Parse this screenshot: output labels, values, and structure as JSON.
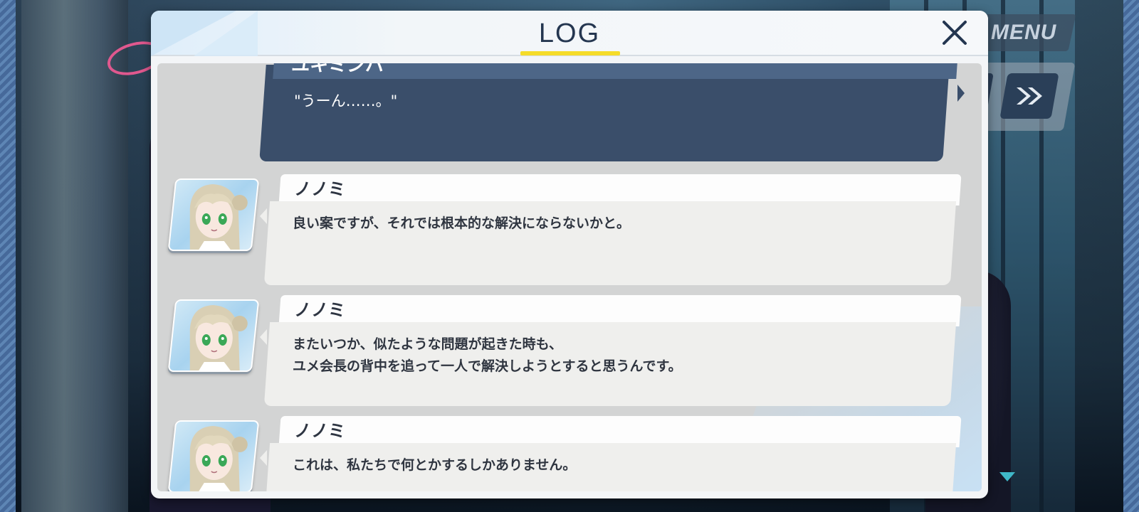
{
  "header": {
    "title": "LOG",
    "menu_label": "MENU"
  },
  "player_entry": {
    "speaker": "ユキミンバ",
    "text": "\"うーん……。\""
  },
  "entries": [
    {
      "speaker": "ノノミ",
      "text": "良い案ですが、それでは根本的な解決にならないかと。"
    },
    {
      "speaker": "ノノミ",
      "text": "またいつか、似たような問題が起きた時も、\nユメ会長の背中を追って一人で解決しようとすると思うんです。"
    },
    {
      "speaker": "ノノミ",
      "text": "これは、私たちで何とかするしかありません。"
    }
  ],
  "colors": {
    "title_underline": "#f5dc2a",
    "player_bubble": "#3a4e6a",
    "title_text": "#243650"
  },
  "icons": {
    "close": "close-icon",
    "skip": "fast-forward-icon",
    "next": "next-arrow-icon"
  }
}
